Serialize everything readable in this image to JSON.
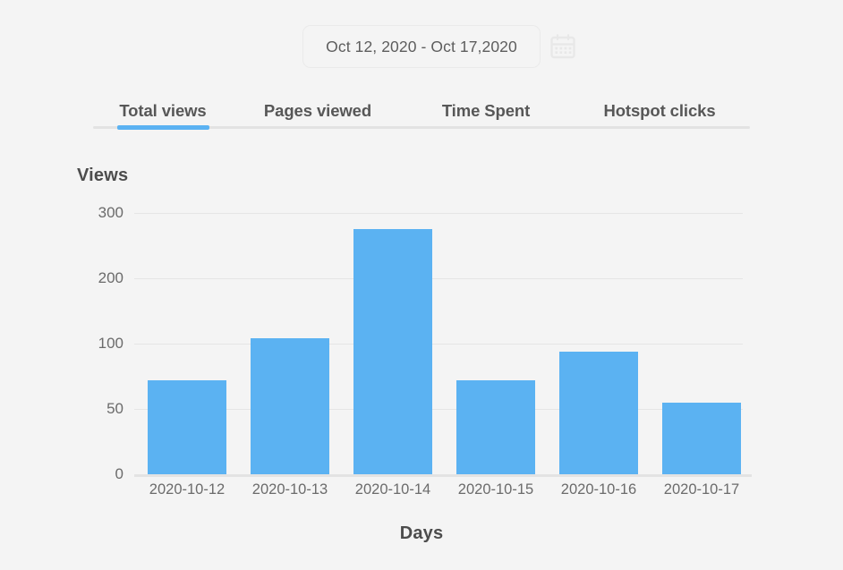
{
  "header": {
    "date_range_label": "Oct 12, 2020 - Oct 17,2020",
    "calendar_icon": "calendar-icon"
  },
  "tabs": {
    "active_index": 0,
    "items": [
      {
        "label": "Total views"
      },
      {
        "label": "Pages viewed"
      },
      {
        "label": "Time Spent"
      },
      {
        "label": "Hotspot clicks"
      }
    ]
  },
  "colors": {
    "bar": "#5bb2f2",
    "accent": "#5bb2f2",
    "grid": "#e5e5e5",
    "background": "#f4f4f4",
    "text": "#6b6b6b",
    "title_text": "#4d4d4d"
  },
  "chart_data": {
    "type": "bar",
    "title": "",
    "ylabel": "Views",
    "xlabel": "Days",
    "categories": [
      "2020-10-12",
      "2020-10-13",
      "2020-10-14",
      "2020-10-15",
      "2020-10-16",
      "2020-10-17"
    ],
    "values": [
      72,
      108,
      275,
      72,
      94,
      55
    ],
    "yticks": [
      0,
      50,
      100,
      200,
      300
    ],
    "ytick_labels": [
      "0",
      "50",
      "100",
      "200",
      "300"
    ],
    "ylim": [
      0,
      300
    ],
    "grid": true,
    "legend": "none",
    "notes": "Y axis uses non-uniform tick spacing: 0, 50, 100, 200, 300 are evenly spaced positions."
  }
}
